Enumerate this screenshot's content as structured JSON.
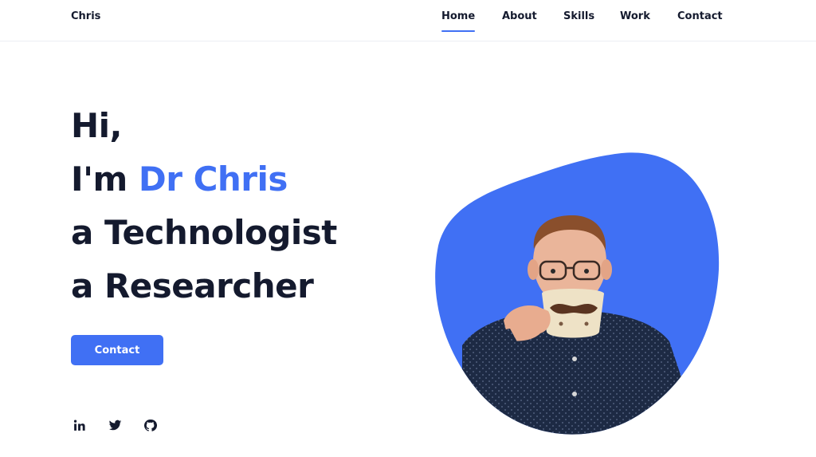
{
  "header": {
    "logo": "Chris",
    "nav": [
      {
        "label": "Home",
        "active": true
      },
      {
        "label": "About",
        "active": false
      },
      {
        "label": "Skills",
        "active": false
      },
      {
        "label": "Work",
        "active": false
      },
      {
        "label": "Contact",
        "active": false
      }
    ]
  },
  "hero": {
    "greeting": "Hi,",
    "intro_prefix": "I'm ",
    "name": "Dr Chris",
    "role_1": "a Technologist",
    "role_2": "a Researcher",
    "contact_label": "Contact"
  },
  "social": [
    {
      "icon": "linkedin-icon"
    },
    {
      "icon": "twitter-icon"
    },
    {
      "icon": "github-icon"
    }
  ],
  "colors": {
    "accent": "#4070f4",
    "text": "#141a2e",
    "background": "#ffffff"
  }
}
